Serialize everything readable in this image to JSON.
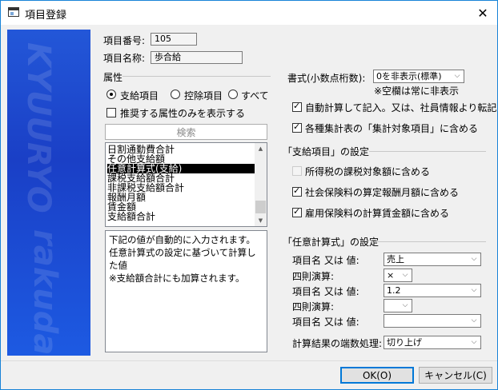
{
  "window": {
    "title": "項目登録",
    "close_glyph": "✕"
  },
  "banner": {
    "watermark_top": "KYUURYO",
    "watermark_bottom": "rakuda"
  },
  "item_number": {
    "label": "項目番号:",
    "value": "105"
  },
  "item_name": {
    "label": "項目名称:",
    "value": "歩合給"
  },
  "attributes": {
    "label": "属性",
    "radios": [
      {
        "label": "支給項目",
        "checked": true
      },
      {
        "label": "控除項目",
        "checked": false
      },
      {
        "label": "すべて",
        "checked": false
      }
    ],
    "recommended_only": {
      "label": "推奨する属性のみを表示する",
      "checked": false
    },
    "search_button": "検索",
    "list_items": [
      "日割通勤費合計",
      "その他支給額",
      "任意計算式(支給)",
      "課税支給額合計",
      "非課税支給額合計",
      "報酬月額",
      "賃金額",
      "支給額合計"
    ],
    "selected_index": 2,
    "description": "下記の値が自動的に入力されます。\n任意計算式の設定に基づいて計算した値\n※支給額合計にも加算されます。"
  },
  "format": {
    "label": "書式(小数点桁数):",
    "value": "0を非表示(標準)",
    "note": "※空欄は常に非表示"
  },
  "options": [
    {
      "label": "自動計算して記入。又は、社員情報より転記",
      "checked": true
    },
    {
      "label": "各種集計表の「集計対象項目」に含める",
      "checked": true
    }
  ],
  "payment_section": {
    "title": "「支給項目」の設定",
    "options": [
      {
        "label": "所得税の課税対象額に含める",
        "checked": false,
        "disabled": true
      },
      {
        "label": "社会保険料の算定報酬月額に含める",
        "checked": true
      },
      {
        "label": "雇用保険料の計算賃金額に含める",
        "checked": true
      }
    ]
  },
  "formula_section": {
    "title": "「任意計算式」の設定",
    "operand1_label": "項目名 又は 値:",
    "operand1_value": "売上",
    "operator1_label": "四則演算:",
    "operator1_value": "×",
    "operand2_label": "項目名 又は 値:",
    "operand2_value": "1.2",
    "operator2_label": "四則演算:",
    "operator2_value": "",
    "operand3_label": "項目名 又は 値:",
    "operand3_value": "",
    "rounding_label": "計算結果の端数処理:",
    "rounding_value": "切り上げ"
  },
  "buttons": {
    "ok": "OK(O)",
    "cancel": "キャンセル(C)"
  }
}
